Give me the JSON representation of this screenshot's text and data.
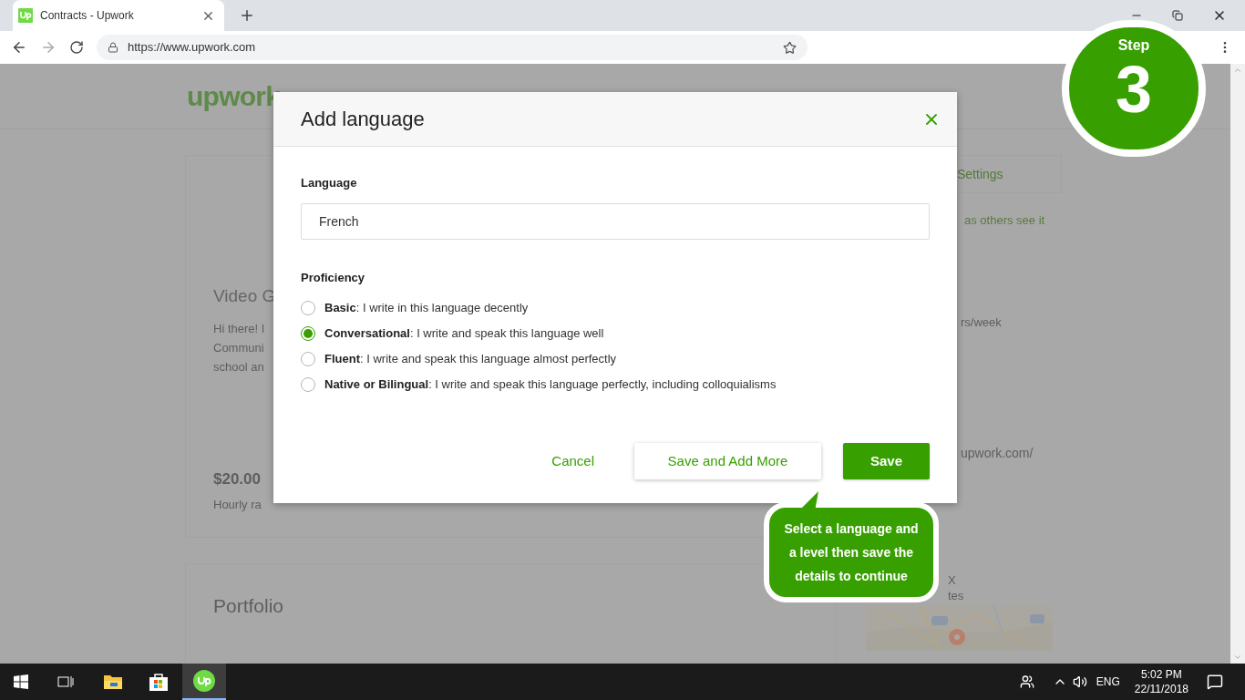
{
  "browser": {
    "tab": {
      "title": "Contracts - Upwork",
      "selected": true
    },
    "url": "https://www.upwork.com"
  },
  "background_page": {
    "logo": "upwork",
    "profile_card": {
      "title": "Video G",
      "lines": [
        "Hi there! I",
        "Communi",
        "school an"
      ],
      "rate": "$20.00",
      "rate_label": "Hourly ra"
    },
    "portfolio": {
      "title": "Portfolio"
    },
    "sidebar": {
      "settings_button": "Settings",
      "view_link": "as others see it",
      "availability": "rs/week",
      "profile_url": "upwork.com/",
      "location_lines": [
        "X",
        "tes"
      ]
    }
  },
  "dialog": {
    "title": "Add language",
    "language": {
      "label": "Language",
      "value": "French"
    },
    "proficiency": {
      "label": "Proficiency",
      "options": [
        {
          "text": "**Basic**: I write in this language decently",
          "selected": false
        },
        {
          "text": "**Conversational**: I write and speak this language well",
          "selected": true
        },
        {
          "text": "**Fluent**: I write and speak this language almost perfectly",
          "selected": false
        },
        {
          "text": "**Native or Bilingual**: I write and speak this language perfectly, including colloquialisms",
          "selected": false
        }
      ]
    },
    "buttons": [
      {
        "label": "Cancel",
        "kind": "link"
      },
      {
        "label": "Save and Add More",
        "kind": "secondary"
      },
      {
        "label": "Save",
        "kind": "primary"
      }
    ]
  },
  "callout": {
    "lines": [
      "Select a language and",
      "a level then save the",
      "details to continue"
    ]
  },
  "step_badge": {
    "label": "Step",
    "number": "3"
  },
  "taskbar": {
    "language": "ENG",
    "time": "5:02 PM",
    "date": "22/11/2018"
  }
}
